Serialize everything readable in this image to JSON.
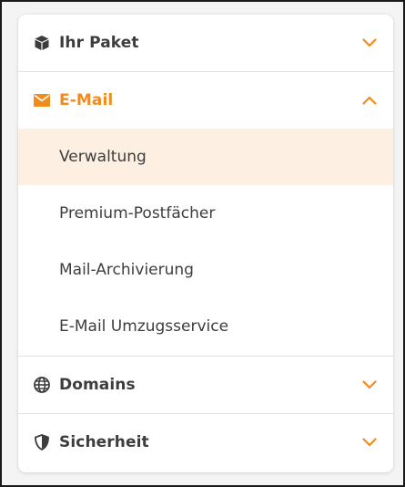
{
  "menu": {
    "accent_color": "#f08c1e",
    "sections": [
      {
        "label": "Ihr Paket",
        "icon": "package-icon",
        "expanded": false
      },
      {
        "label": "E-Mail",
        "icon": "envelope-icon",
        "expanded": true,
        "items": [
          {
            "label": "Verwaltung",
            "selected": true
          },
          {
            "label": "Premium-Postfächer",
            "selected": false
          },
          {
            "label": "Mail-Archivierung",
            "selected": false
          },
          {
            "label": "E-Mail Umzugsservice",
            "selected": false
          }
        ]
      },
      {
        "label": "Domains",
        "icon": "globe-icon",
        "expanded": false
      },
      {
        "label": "Sicherheit",
        "icon": "shield-icon",
        "expanded": false
      }
    ]
  }
}
